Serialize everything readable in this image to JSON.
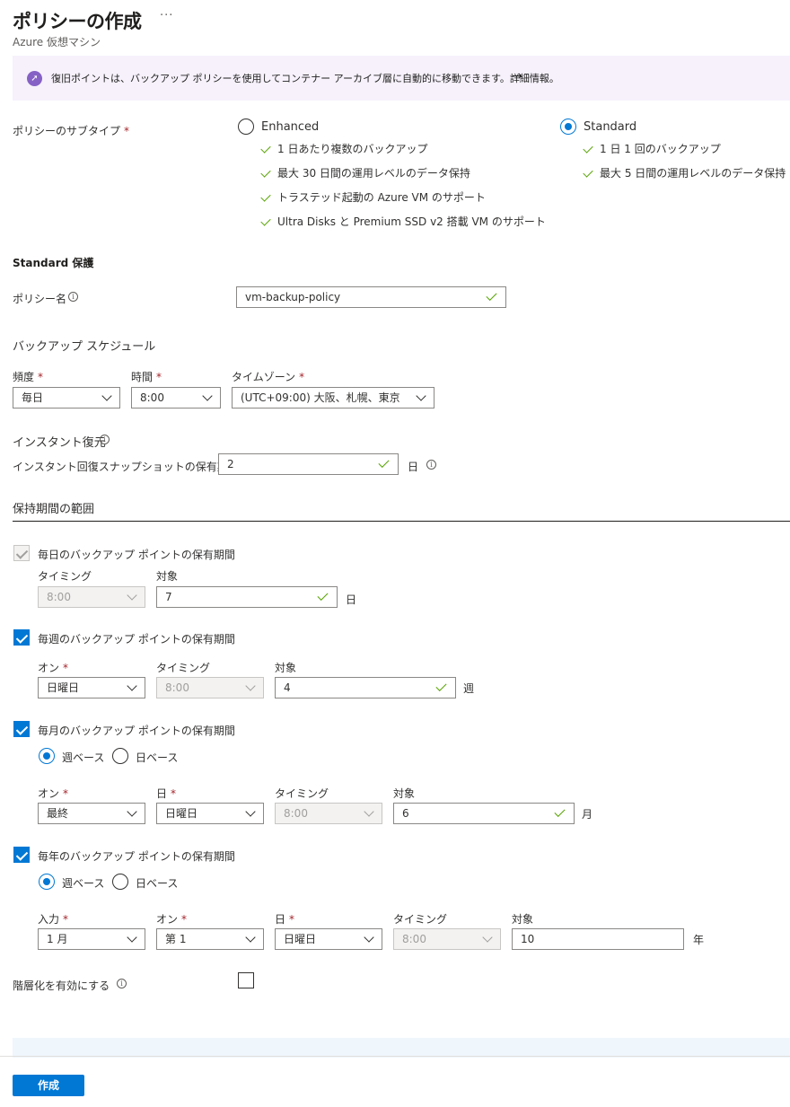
{
  "header": {
    "title": "ポリシーの作成",
    "more": "···",
    "subtitle": "Azure 仮想マシン"
  },
  "banner": {
    "icon": "rocket-icon",
    "text": "復旧ポイントは、バックアップ ポリシーを使用してコンテナー アーカイブ層に自動的に移動できます。詳細情報。",
    "arrow": "→"
  },
  "subtype": {
    "label": "ポリシーのサブタイプ",
    "required": "*",
    "enhanced": {
      "label": "Enhanced",
      "selected": false,
      "features": [
        "1 日あたり複数のバックアップ",
        "最大 30 日間の運用レベルのデータ保持",
        "トラステッド起動の Azure VM のサポート",
        "Ultra Disks と Premium SSD v2 搭載 VM のサポート"
      ]
    },
    "standard": {
      "label": "Standard",
      "selected": true,
      "features": [
        "1 日 1 回のバックアップ",
        "最大 5 日間の運用レベルのデータ保持"
      ]
    }
  },
  "protection_title": "Standard 保護",
  "policy_name": {
    "label": "ポリシー名",
    "value": "vm-backup-policy"
  },
  "schedule": {
    "title": "バックアップ スケジュール",
    "frequency_label": "頻度",
    "frequency_value": "毎日",
    "time_label": "時間",
    "time_value": "8:00",
    "timezone_label": "タイムゾーン",
    "timezone_value": "(UTC+09:00) 大阪、札幌、東京",
    "required": "*"
  },
  "instant_restore": {
    "title": "インスタント復元",
    "retention_label": "インスタント回復スナップショットの保有期間",
    "retention_value": "2",
    "unit": "日"
  },
  "retention_range": {
    "title": "保持期間の範囲",
    "daily": {
      "label": "毎日のバックアップ ポイントの保有期間",
      "timing_label": "タイミング",
      "timing_value": "8:00",
      "target_label": "対象",
      "target_value": "7",
      "unit": "日"
    },
    "weekly": {
      "label": "毎週のバックアップ ポイントの保有期間",
      "on_label": "オン",
      "on_value": "日曜日",
      "timing_label": "タイミング",
      "timing_value": "8:00",
      "target_label": "対象",
      "target_value": "4",
      "unit": "週"
    },
    "monthly": {
      "label": "毎月のバックアップ ポイントの保有期間",
      "week_based": "週ベース",
      "day_based": "日ベース",
      "on_label": "オン",
      "on_value": "最終",
      "day_label": "日",
      "day_value": "日曜日",
      "timing_label": "タイミング",
      "timing_value": "8:00",
      "target_label": "対象",
      "target_value": "6",
      "unit": "月"
    },
    "yearly": {
      "label": "毎年のバックアップ ポイントの保有期間",
      "week_based": "週ベース",
      "day_based": "日ベース",
      "input_label": "入力",
      "input_value": "1 月",
      "on_label": "オン",
      "on_value": "第 1",
      "day_label": "日",
      "day_value": "日曜日",
      "timing_label": "タイミング",
      "timing_value": "8:00",
      "target_label": "対象",
      "target_value": "10",
      "unit": "年"
    }
  },
  "tiering": {
    "label": "階層化を有効にする"
  },
  "footer": {
    "create_label": "作成"
  },
  "colors": {
    "accent": "#0078d4",
    "valid": "#57a300",
    "banner_bg": "#f6f1fb",
    "required": "#a4262c"
  }
}
